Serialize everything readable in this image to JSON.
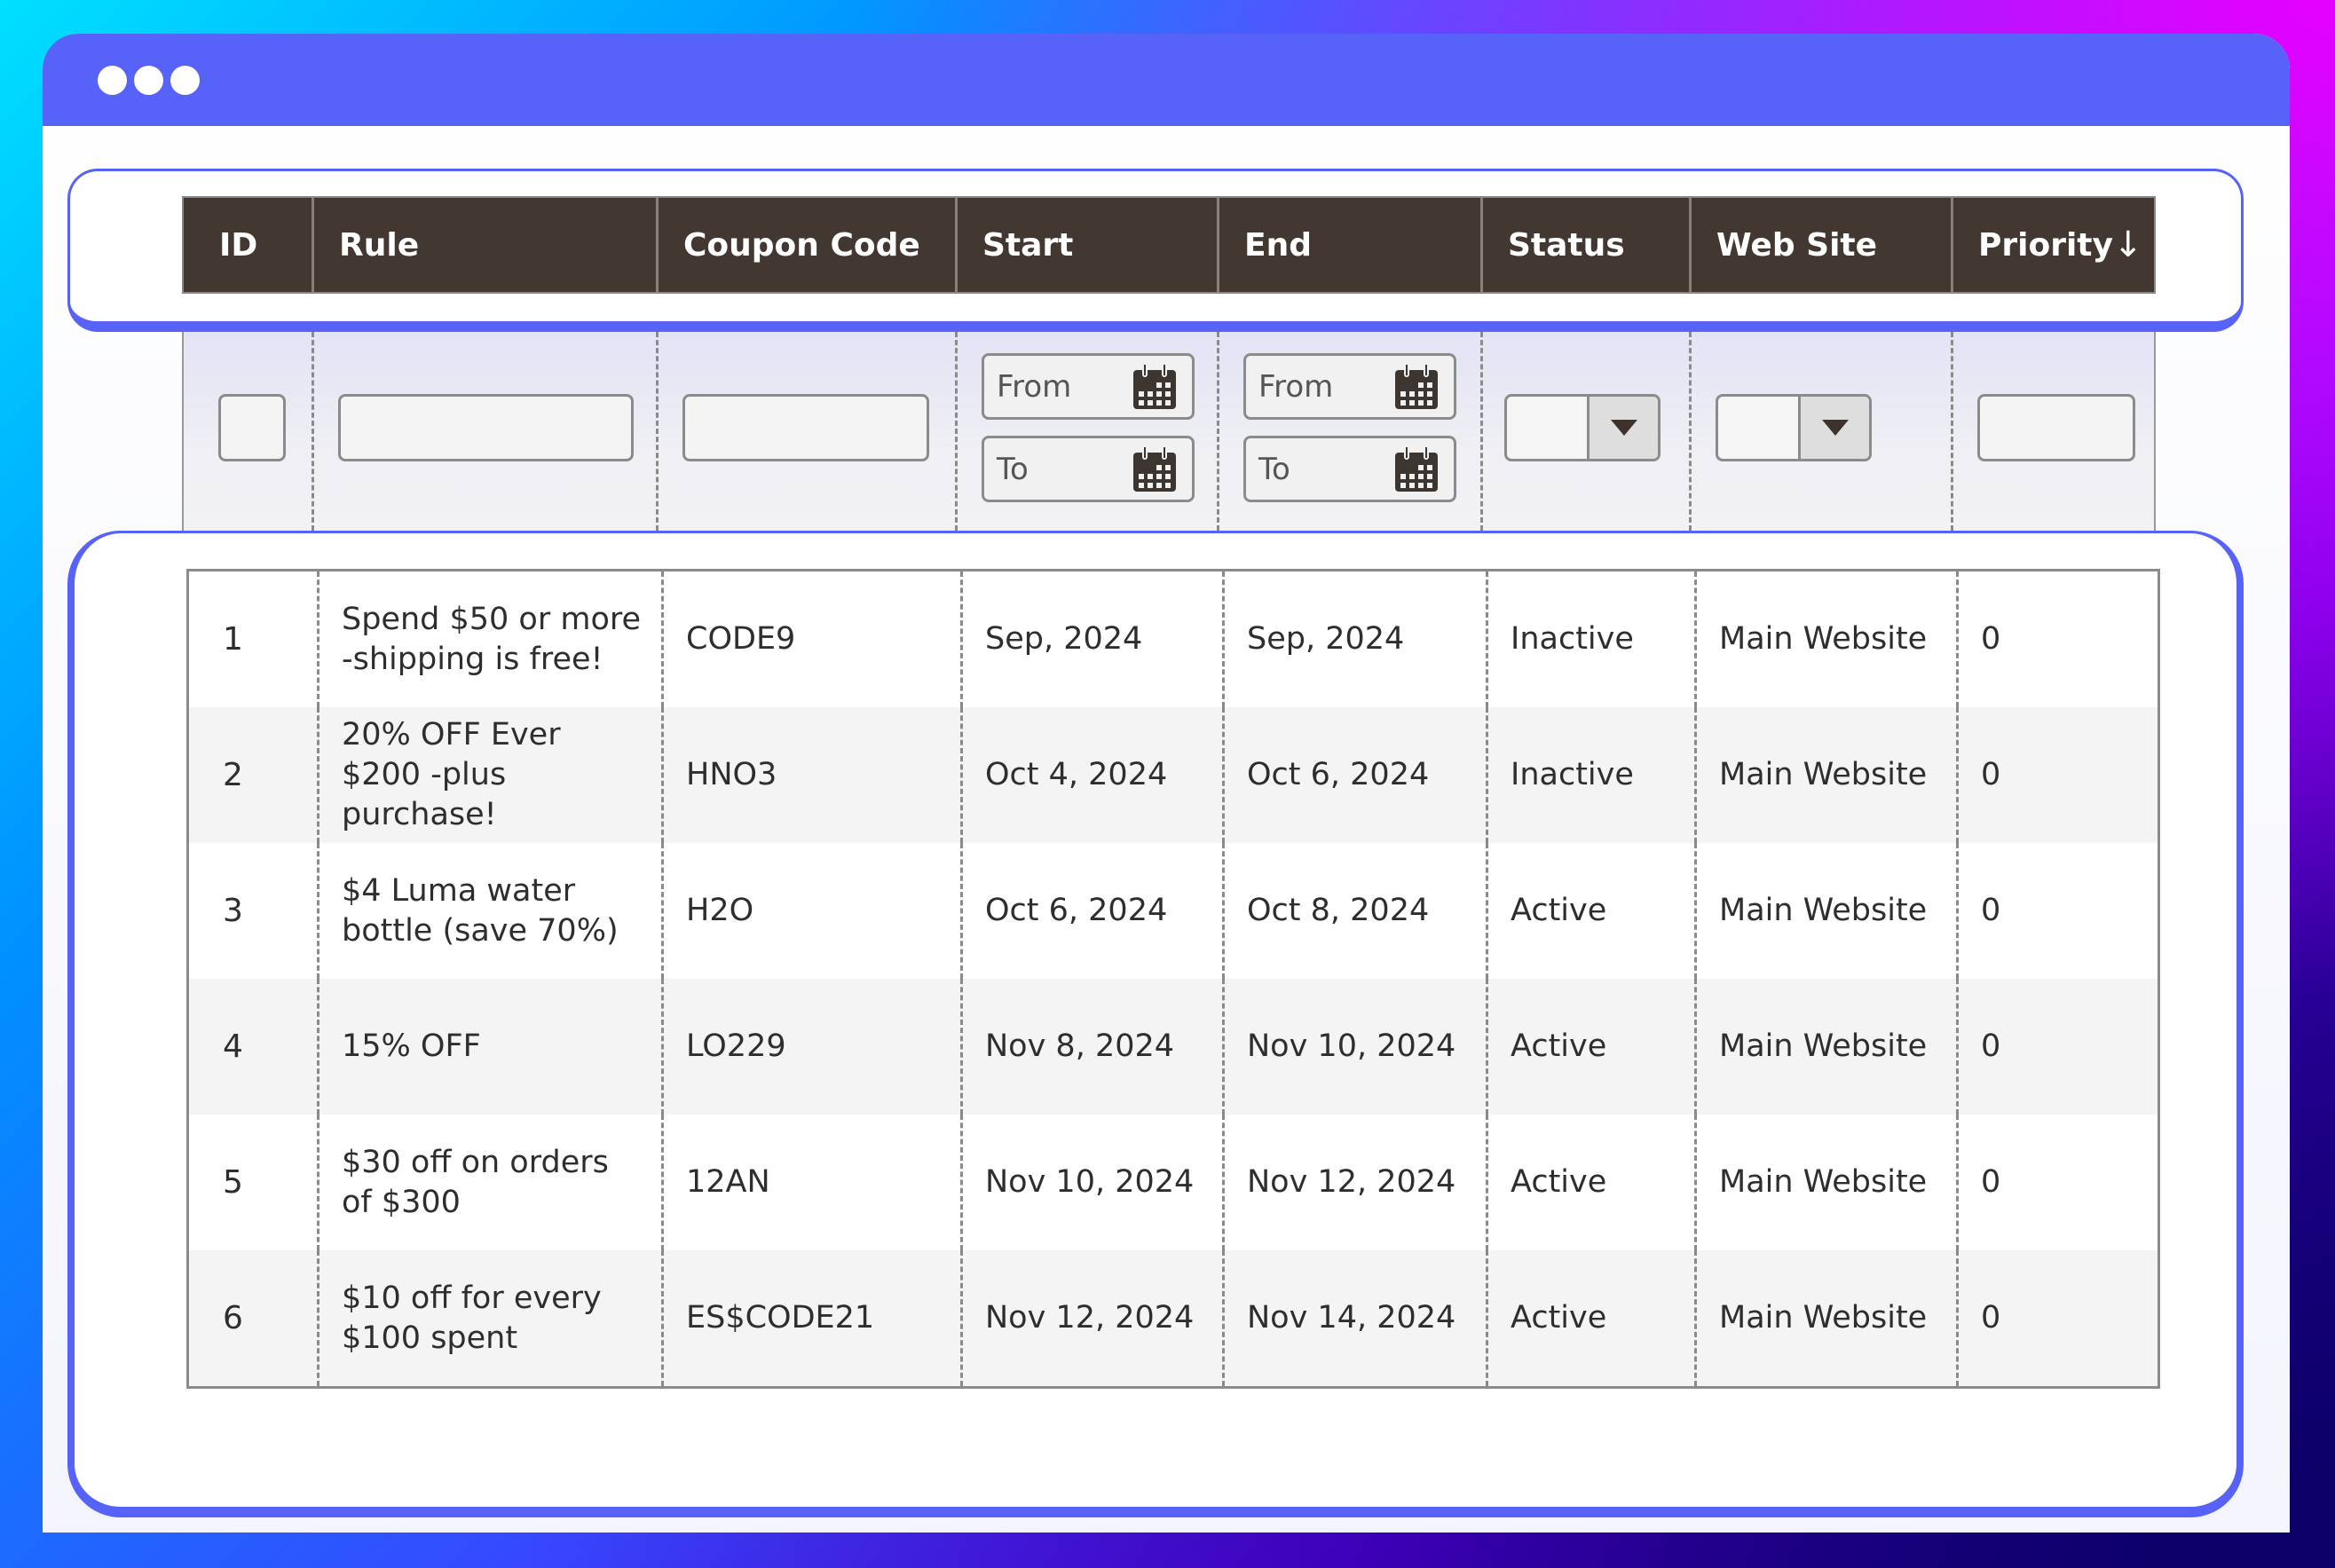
{
  "window": {
    "title_dots": 3,
    "colors": {
      "accent": "#5763f8",
      "header_bg": "#433831",
      "row_alt": "#f4f4f4"
    }
  },
  "table": {
    "columns": [
      {
        "label": "ID"
      },
      {
        "label": "Rule"
      },
      {
        "label": "Coupon Code"
      },
      {
        "label": "Start"
      },
      {
        "label": "End"
      },
      {
        "label": "Status"
      },
      {
        "label": "Web Site"
      },
      {
        "label": "Priority",
        "sort_icon": "arrow-down-icon",
        "sort_glyph": "↓"
      }
    ],
    "filters": {
      "id_value": "",
      "rule_value": "",
      "coupon_value": "",
      "start_from_placeholder": "From",
      "start_to_placeholder": "To",
      "end_from_placeholder": "From",
      "end_to_placeholder": "To",
      "status_selected": "",
      "website_selected": "",
      "priority_value": ""
    },
    "rows": [
      {
        "id": "1",
        "rule": "Spend $50 or more -shipping is free!",
        "code": "CODE9",
        "start": "Sep, 2024",
        "end": "Sep, 2024",
        "status": "Inactive",
        "website": "Main Website",
        "priority": "0"
      },
      {
        "id": "2",
        "rule": "20% OFF Ever $200 -plus purchase!",
        "code": "HNO3",
        "start": "Oct 4, 2024",
        "end": "Oct 6, 2024",
        "status": "Inactive",
        "website": "Main Website",
        "priority": "0"
      },
      {
        "id": "3",
        "rule": "$4 Luma water bottle (save 70%)",
        "code": "H2O",
        "start": "Oct 6, 2024",
        "end": "Oct 8, 2024",
        "status": "Active",
        "website": "Main Website",
        "priority": "0"
      },
      {
        "id": "4",
        "rule": "15% OFF",
        "code": "LO229",
        "start": "Nov 8, 2024",
        "end": "Nov 10, 2024",
        "status": "Active",
        "website": "Main Website",
        "priority": "0"
      },
      {
        "id": "5",
        "rule": "$30 off on orders of $300",
        "code": "12AN",
        "start": "Nov 10, 2024",
        "end": "Nov 12, 2024",
        "status": "Active",
        "website": "Main Website",
        "priority": "0"
      },
      {
        "id": "6",
        "rule": "$10 off for every $100 spent",
        "code": "ES$CODE21",
        "start": "Nov 12, 2024",
        "end": "Nov 14, 2024",
        "status": "Active",
        "website": "Main Website",
        "priority": "0"
      }
    ]
  }
}
